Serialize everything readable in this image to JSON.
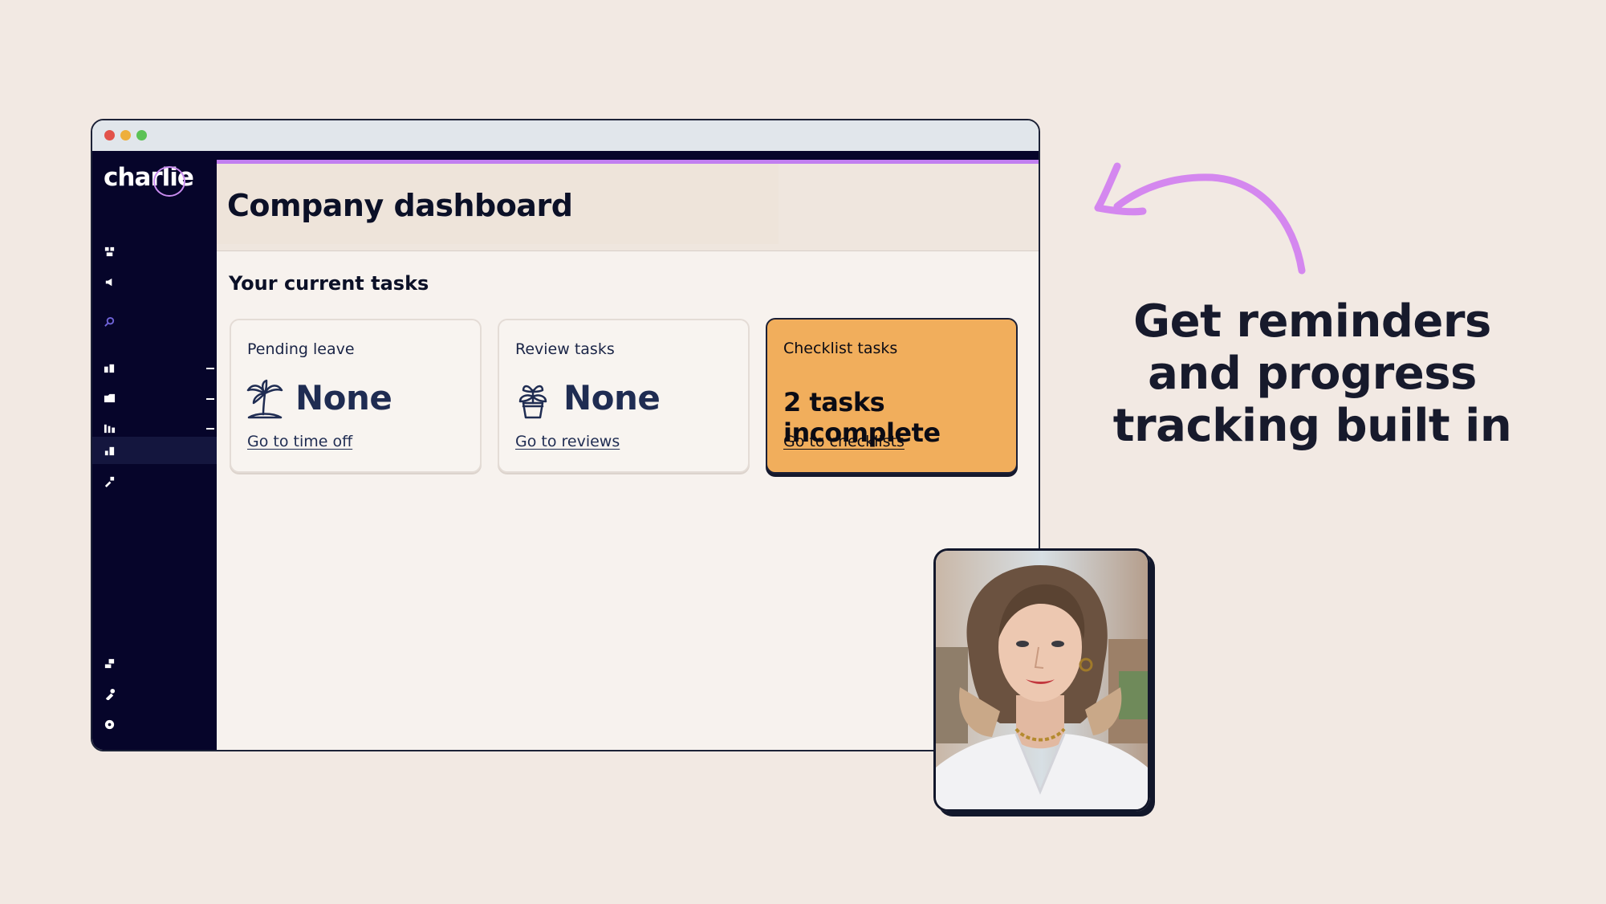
{
  "brand": {
    "logo_text": "charlie"
  },
  "sidebar": {
    "top_icons": [
      "team-icon",
      "announcements-icon",
      "search-icon"
    ],
    "items": [
      {
        "icon": "people-icon",
        "expandable": true
      },
      {
        "icon": "folder-icon",
        "expandable": true
      },
      {
        "icon": "calendar-icon",
        "expandable": true
      },
      {
        "icon": "org-chart-icon",
        "expandable": true
      },
      {
        "icon": "reports-icon",
        "expandable": false,
        "active": true
      },
      {
        "icon": "tools-icon",
        "expandable": false
      }
    ],
    "bottom_icons": [
      "swap-icon",
      "settings-wrench-icon",
      "help-icon"
    ]
  },
  "page": {
    "title": "Company dashboard"
  },
  "tasks": {
    "section_title": "Your current tasks",
    "cards": [
      {
        "label": "Pending leave",
        "value": "None",
        "icon": "palm-tree-icon",
        "link": "Go to time off"
      },
      {
        "label": "Review tasks",
        "value": "None",
        "icon": "potted-plant-icon",
        "link": "Go to reviews"
      },
      {
        "label": "Checklist tasks",
        "value": "2 tasks incomplete",
        "link": "Go to checklists",
        "highlight_color": "#f1ae5c"
      }
    ]
  },
  "promo": {
    "tagline_lines": [
      "Get reminders",
      "and progress",
      "tracking built in"
    ]
  },
  "colors": {
    "sidebar_bg": "#06052a",
    "accent_purple": "#c17ff0",
    "highlight_orange": "#f1ae5c",
    "page_bg": "#f2e9e3"
  }
}
